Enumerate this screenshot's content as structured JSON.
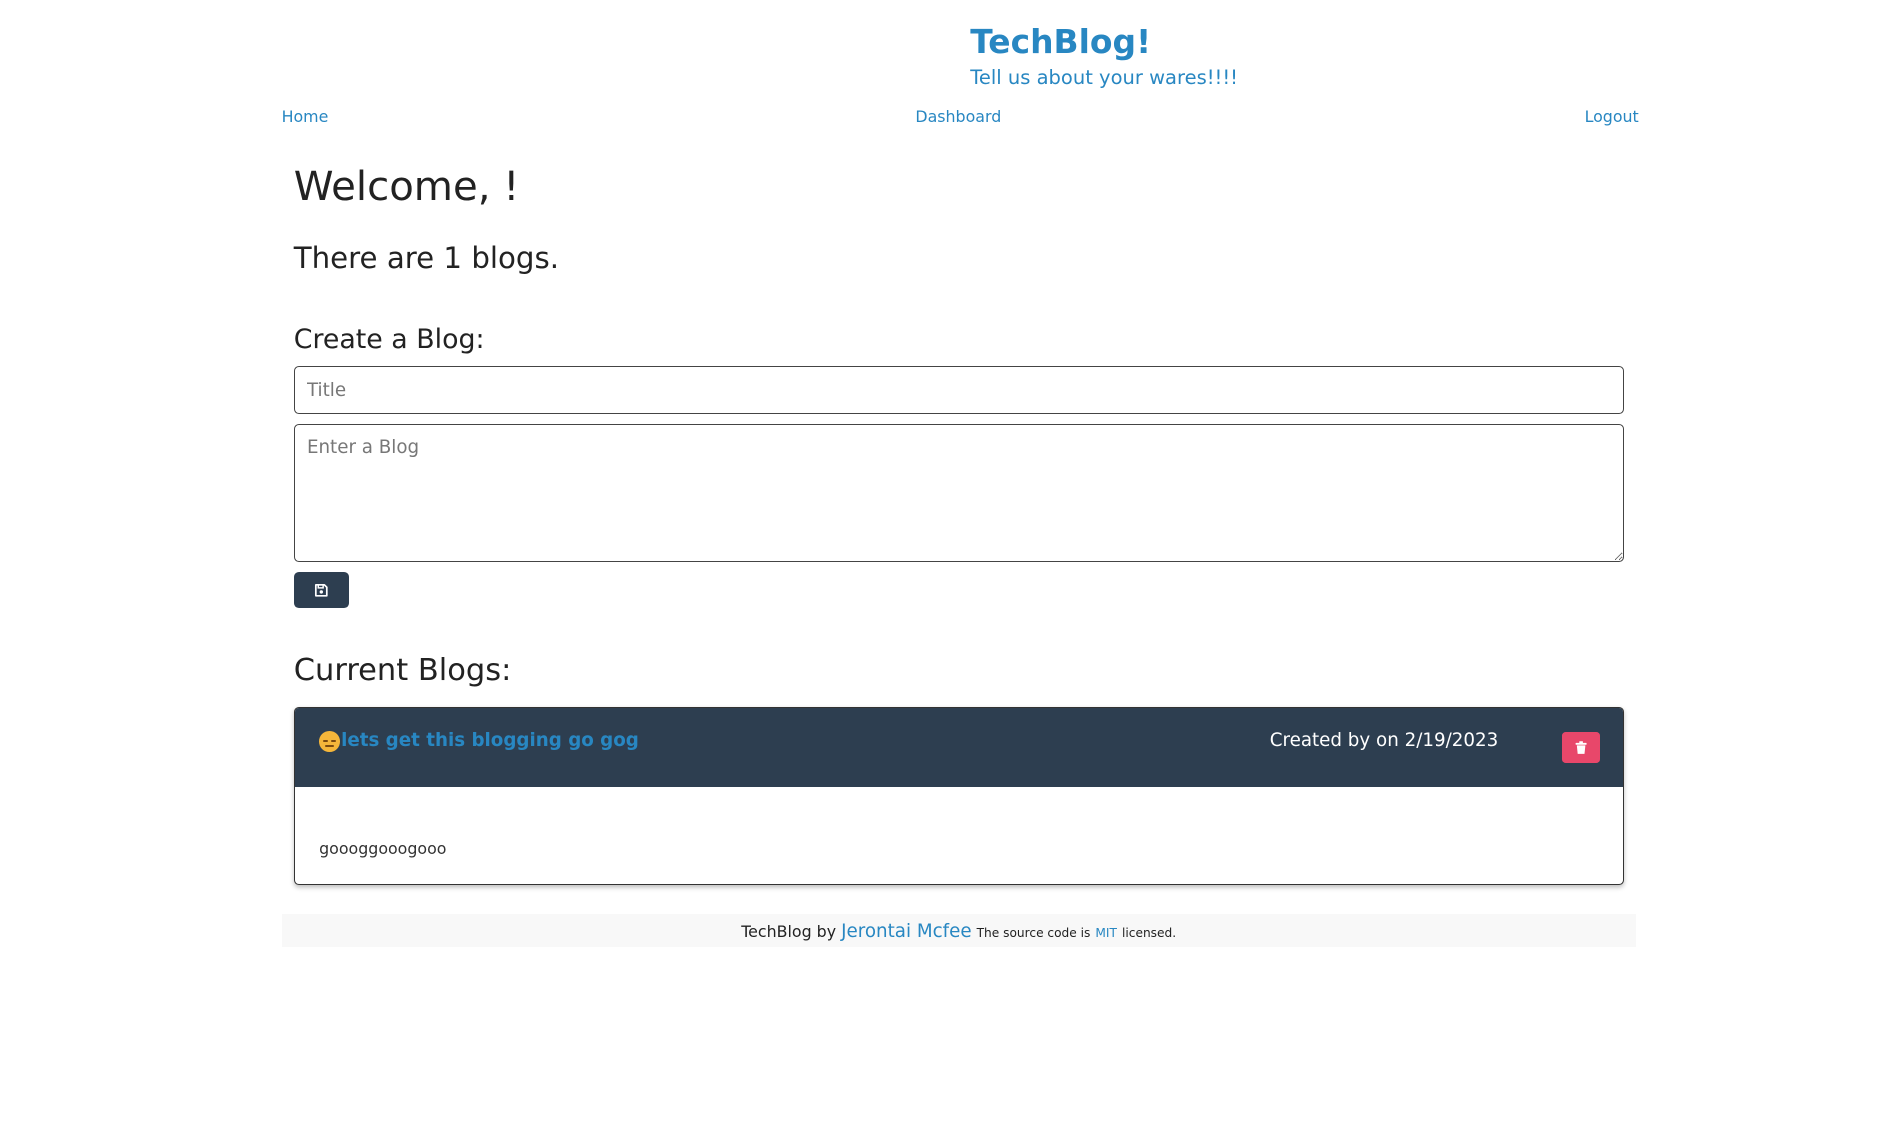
{
  "header": {
    "title": "TechBlog!",
    "subtitle": "Tell us about your wares!!!!"
  },
  "nav": {
    "home": "Home",
    "dashboard": "Dashboard",
    "logout": "Logout"
  },
  "main": {
    "welcome": "Welcome, !",
    "blog_count_text": "There are 1 blogs.",
    "create_heading": "Create a Blog:",
    "title_placeholder": "Title",
    "body_placeholder": "Enter a Blog",
    "save_icon": "save-icon",
    "current_heading": "Current Blogs:"
  },
  "blogs": [
    {
      "emoji_icon": "sleepy-face-emoji",
      "title": "lets get this blogging go gog",
      "created": "Created by on 2/19/2023",
      "body": "goooggooogooo",
      "delete_icon": "trash-icon",
      "delete_color": "#e8476a"
    }
  ],
  "footer": {
    "prefix": "TechBlog by",
    "author": "Jerontai Mcfee",
    "license_pre": "The source code is",
    "license_link": "MIT",
    "license_post": "licensed."
  },
  "colors": {
    "accent": "#2887c2",
    "card_header": "#2d3e50",
    "delete": "#e8476a"
  }
}
